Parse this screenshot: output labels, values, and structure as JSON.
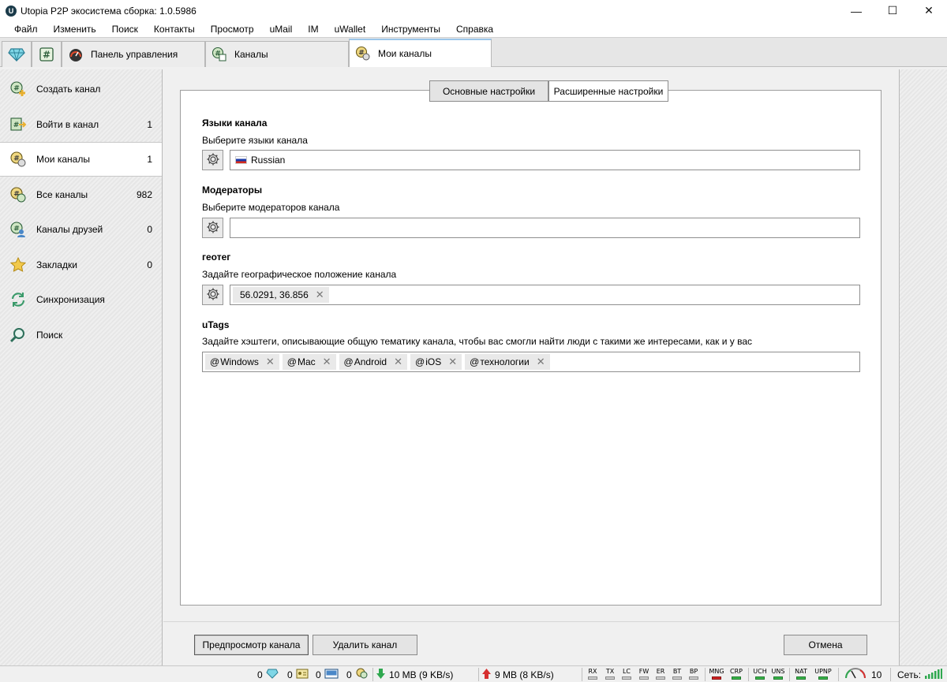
{
  "window": {
    "title": "Utopia P2P экосистема сборка: 1.0.5986",
    "controls": {
      "minimize": "—",
      "maximize": "☐",
      "close": "✕"
    }
  },
  "menu": [
    "Файл",
    "Изменить",
    "Поиск",
    "Контакты",
    "Просмотр",
    "uMail",
    "IM",
    "uWallet",
    "Инструменты",
    "Справка"
  ],
  "tabs": {
    "dashboard": "Панель управления",
    "channels": "Каналы",
    "my_channels": "Мои каналы"
  },
  "sidebar": {
    "items": [
      {
        "label": "Создать канал",
        "count": "",
        "icon": "create-channel-icon"
      },
      {
        "label": "Войти в канал",
        "count": "1",
        "icon": "join-channel-icon"
      },
      {
        "label": "Мои каналы",
        "count": "1",
        "icon": "my-channels-icon"
      },
      {
        "label": "Все каналы",
        "count": "982",
        "icon": "all-channels-icon"
      },
      {
        "label": "Каналы друзей",
        "count": "0",
        "icon": "friends-channels-icon"
      },
      {
        "label": "Закладки",
        "count": "0",
        "icon": "star-icon"
      },
      {
        "label": "Синхронизация",
        "count": "",
        "icon": "sync-icon"
      },
      {
        "label": "Поиск",
        "count": "",
        "icon": "search-icon"
      }
    ]
  },
  "subtabs": {
    "basic": "Основные настройки",
    "advanced": "Расширенные настройки"
  },
  "languages": {
    "title": "Языки канала",
    "desc": "Выберите языки канала",
    "value": "Russian"
  },
  "moderators": {
    "title": "Модераторы",
    "desc": "Выберите модераторов канала",
    "value": ""
  },
  "geotag": {
    "title": "геотег",
    "desc": "Задайте географическое положение канала",
    "value": "56.0291, 36.856"
  },
  "utags": {
    "title": "uTags",
    "desc": "Задайте хэштеги, описывающие общую тематику канала, чтобы вас смогли найти люди с такими же интересами, как и у вас",
    "at": "@",
    "tags": [
      "Windows",
      "Mac",
      "Android",
      "iOS",
      "технологии"
    ]
  },
  "buttons": {
    "preview": "Предпросмотр канала",
    "delete": "Удалить канал",
    "cancel": "Отмена"
  },
  "status": {
    "count1": "0",
    "count2": "0",
    "count3": "0",
    "count4": "0",
    "download": "10 MB (9 KB/s)",
    "upload": "9 MB (8 KB/s)",
    "indicators": [
      {
        "label": "RX",
        "state": "off"
      },
      {
        "label": "TX",
        "state": "off"
      },
      {
        "label": "LC",
        "state": "off"
      },
      {
        "label": "FW",
        "state": "off"
      },
      {
        "label": "ER",
        "state": "off"
      },
      {
        "label": "BT",
        "state": "off"
      },
      {
        "label": "BP",
        "state": "off"
      },
      {
        "label": "MNG",
        "state": "red"
      },
      {
        "label": "CRP",
        "state": "green"
      },
      {
        "label": "UCH",
        "state": "green"
      },
      {
        "label": "UNS",
        "state": "green"
      },
      {
        "label": "NAT",
        "state": "green"
      },
      {
        "label": "UPNP",
        "state": "green"
      }
    ],
    "speed": "10",
    "network_label": "Сеть:"
  }
}
